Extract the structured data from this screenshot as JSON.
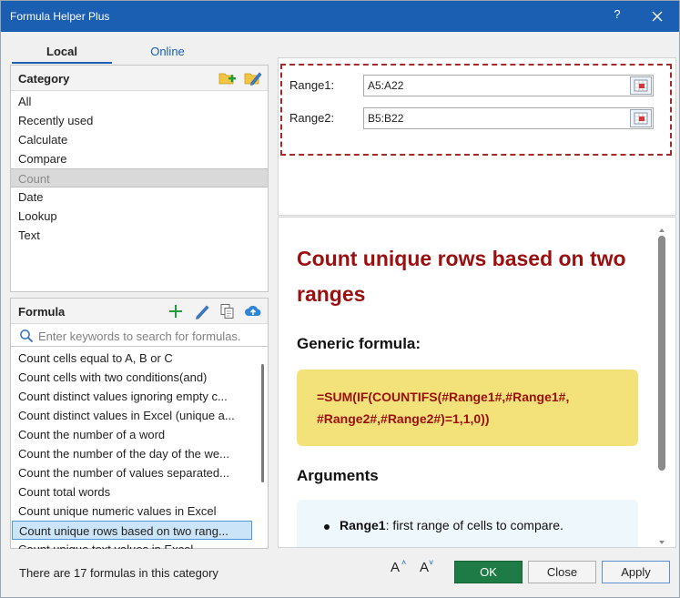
{
  "window": {
    "title": "Formula Helper Plus",
    "help_label": "?"
  },
  "tabs": [
    {
      "label": "Local"
    },
    {
      "label": "Online"
    }
  ],
  "category": {
    "header": "Category",
    "items": [
      "All",
      "Recently used",
      "Calculate",
      "Compare",
      "Count",
      "Date",
      "Lookup",
      "Text"
    ],
    "selected": "Count"
  },
  "formula": {
    "header": "Formula",
    "search_placeholder": "Enter keywords to search for formulas.",
    "items": [
      "Count cells equal to A, B or C",
      "Count cells with two conditions(and)",
      "Count distinct values ignoring empty c...",
      "Count distinct values in Excel (unique a...",
      "Count the number of a word",
      "Count the number of the day of the we...",
      "Count the number of values separated...",
      "Count total words",
      "Count unique numeric values in Excel",
      "Count unique rows based on two rang...",
      "Count unique text values in Excel"
    ],
    "selected": "Count unique rows based on two rang..."
  },
  "ranges": [
    {
      "label": "Range1:",
      "value": "A5:A22"
    },
    {
      "label": "Range2:",
      "value": "B5:B22"
    }
  ],
  "article": {
    "title": "Count unique rows based on two ranges",
    "generic_heading": "Generic formula:",
    "formula_text": "=SUM(IF(COUNTIFS(#Range1#,#Range1#, #Range2#,#Range2#)=1,1,0))",
    "arguments_heading": "Arguments",
    "arg1_name": "Range1",
    "arg1_desc": ": first range of cells to compare."
  },
  "footer": {
    "status": "There are 17 formulas in this category",
    "font_larger": "A",
    "font_smaller": "A",
    "ok_label": "OK",
    "close_label": "Close",
    "apply_label": "Apply"
  },
  "colors": {
    "titlebar": "#1b5fb3",
    "accent_red": "#9b0f0f",
    "formula_bg": "#f3e27a",
    "ok_green": "#1e7b45"
  },
  "icons": [
    "close-icon",
    "add-category-icon",
    "edit-category-icon",
    "add-formula-icon",
    "edit-formula-icon",
    "copy-formula-icon",
    "cloud-upload-icon",
    "search-icon",
    "range-select-icon",
    "increase-font-icon",
    "decrease-font-icon"
  ]
}
